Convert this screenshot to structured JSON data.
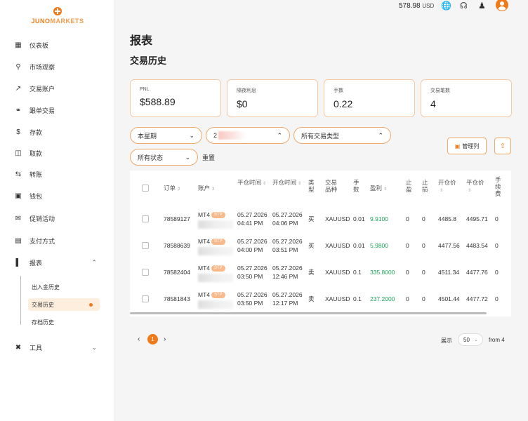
{
  "brand": {
    "name_part1": "JUNO",
    "name_part2": "MARKETS"
  },
  "topbar": {
    "balance": "578.98",
    "currency": "USD"
  },
  "sidebar": {
    "items": [
      {
        "label": "仪表板"
      },
      {
        "label": "市场观察"
      },
      {
        "label": "交易账户"
      },
      {
        "label": "跟单交易"
      },
      {
        "label": "存款"
      },
      {
        "label": "取款"
      },
      {
        "label": "转账"
      },
      {
        "label": "钱包"
      },
      {
        "label": "促销活动"
      },
      {
        "label": "支付方式"
      },
      {
        "label": "报表"
      },
      {
        "label": "工具"
      }
    ],
    "sub_items": [
      {
        "label": "出入金历史"
      },
      {
        "label": "交易历史"
      },
      {
        "label": "存档历史"
      }
    ]
  },
  "page": {
    "title": "报表",
    "section": "交易历史"
  },
  "stats": [
    {
      "label": "PNL",
      "value": "$588.89"
    },
    {
      "label": "隔夜利息",
      "value": "$0"
    },
    {
      "label": "手数",
      "value": "0.22"
    },
    {
      "label": "交易笔数",
      "value": "4"
    }
  ],
  "filters": {
    "period": "本星期",
    "account_prefix": "2",
    "trade_type": "所有交易类型",
    "status": "所有状态",
    "reset": "重置",
    "manage_columns": "管理列"
  },
  "table": {
    "headers": {
      "order": "订单",
      "account": "账户",
      "close_time": "平仓时间",
      "open_time": "开仓时间",
      "type": "类型",
      "symbol": "交易品种",
      "lots": "手数",
      "profit": "盈利",
      "tp": "止盈",
      "sl": "止损",
      "open_price": "开仓价",
      "close_price": "平仓价",
      "fee": "手续费"
    },
    "rows": [
      {
        "order": "78589127",
        "platform": "MT4",
        "tag": "STP",
        "close_date": "05.27.2026",
        "close_time": "04:41 PM",
        "open_date": "05.27.2026",
        "open_time": "04:06 PM",
        "type": "买",
        "symbol": "XAUUSD",
        "lots": "0.01",
        "profit": "9.9100",
        "tp": "0",
        "sl": "0",
        "open_price": "4485.8",
        "close_price": "4495.71",
        "fee": "0"
      },
      {
        "order": "78588639",
        "platform": "MT4",
        "tag": "STP",
        "close_date": "05.27.2026",
        "close_time": "04:00 PM",
        "open_date": "05.27.2026",
        "open_time": "03:51 PM",
        "type": "买",
        "symbol": "XAUUSD",
        "lots": "0.01",
        "profit": "5.9800",
        "tp": "0",
        "sl": "0",
        "open_price": "4477.56",
        "close_price": "4483.54",
        "fee": "0"
      },
      {
        "order": "78582404",
        "platform": "MT4",
        "tag": "STP",
        "close_date": "05.27.2026",
        "close_time": "03:50 PM",
        "open_date": "05.27.2026",
        "open_time": "12:46 PM",
        "type": "卖",
        "symbol": "XAUUSD",
        "lots": "0.1",
        "profit": "335.8000",
        "tp": "0",
        "sl": "0",
        "open_price": "4511.34",
        "close_price": "4477.76",
        "fee": "0"
      },
      {
        "order": "78581843",
        "platform": "MT4",
        "tag": "STP",
        "close_date": "05.27.2026",
        "close_time": "03:50 PM",
        "open_date": "05.27.2026",
        "open_time": "12:17 PM",
        "type": "卖",
        "symbol": "XAUUSD",
        "lots": "0.1",
        "profit": "237.2000",
        "tp": "0",
        "sl": "0",
        "open_price": "4501.44",
        "close_price": "4477.72",
        "fee": "0"
      }
    ]
  },
  "pagination": {
    "current": "1",
    "show_label": "展示",
    "per_page": "50",
    "from_label": "from 4"
  },
  "colors": {
    "accent": "#f07a1a",
    "profit": "#1fa35a"
  }
}
